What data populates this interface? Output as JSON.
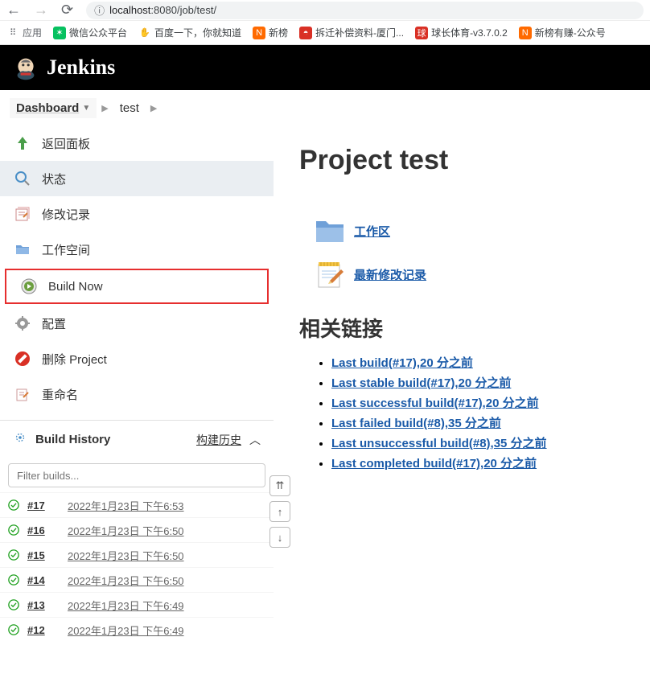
{
  "browser": {
    "url_host": "localhost",
    "url_port_path": ":8080/job/test/"
  },
  "bookmarks": [
    {
      "label": "应用",
      "icon": "apps"
    },
    {
      "label": "微信公众平台",
      "icon": "wechat"
    },
    {
      "label": "百度一下，你就知道",
      "icon": "baidu"
    },
    {
      "label": "新榜",
      "icon": "xinbang"
    },
    {
      "label": "拆迁补偿资料-厦门...",
      "icon": "red"
    },
    {
      "label": "球长体育-v3.7.0.2",
      "icon": "red2"
    },
    {
      "label": "新榜有赚-公众号",
      "icon": "xinbang"
    }
  ],
  "header": {
    "brand": "Jenkins"
  },
  "breadcrumbs": {
    "dashboard": "Dashboard",
    "job": "test"
  },
  "sidebar": {
    "items": [
      {
        "label": "返回面板",
        "name": "back-to-dashboard"
      },
      {
        "label": "状态",
        "name": "status"
      },
      {
        "label": "修改记录",
        "name": "changes"
      },
      {
        "label": "工作空间",
        "name": "workspace"
      },
      {
        "label": "Build Now",
        "name": "build-now"
      },
      {
        "label": "配置",
        "name": "configure"
      },
      {
        "label": "删除 Project",
        "name": "delete-project"
      },
      {
        "label": "重命名",
        "name": "rename"
      }
    ]
  },
  "build_history": {
    "title": "Build History",
    "link_label": "构建历史",
    "filter_placeholder": "Filter builds..."
  },
  "builds": [
    {
      "num": "#17",
      "date": "2022年1月23日 下午6:53"
    },
    {
      "num": "#16",
      "date": "2022年1月23日 下午6:50"
    },
    {
      "num": "#15",
      "date": "2022年1月23日 下午6:50"
    },
    {
      "num": "#14",
      "date": "2022年1月23日 下午6:50"
    },
    {
      "num": "#13",
      "date": "2022年1月23日 下午6:49"
    },
    {
      "num": "#12",
      "date": "2022年1月23日 下午6:49"
    }
  ],
  "content": {
    "title": "Project test",
    "quick_links": [
      {
        "label": "工作区",
        "name": "workspace-link"
      },
      {
        "label": "最新修改记录",
        "name": "latest-changes-link"
      }
    ],
    "related_heading": "相关链接",
    "related_links": [
      "Last build(#17),20 分之前",
      "Last stable build(#17),20 分之前",
      "Last successful build(#17),20 分之前",
      "Last failed build(#8),35 分之前",
      "Last unsuccessful build(#8),35 分之前",
      "Last completed build(#17),20 分之前"
    ]
  }
}
